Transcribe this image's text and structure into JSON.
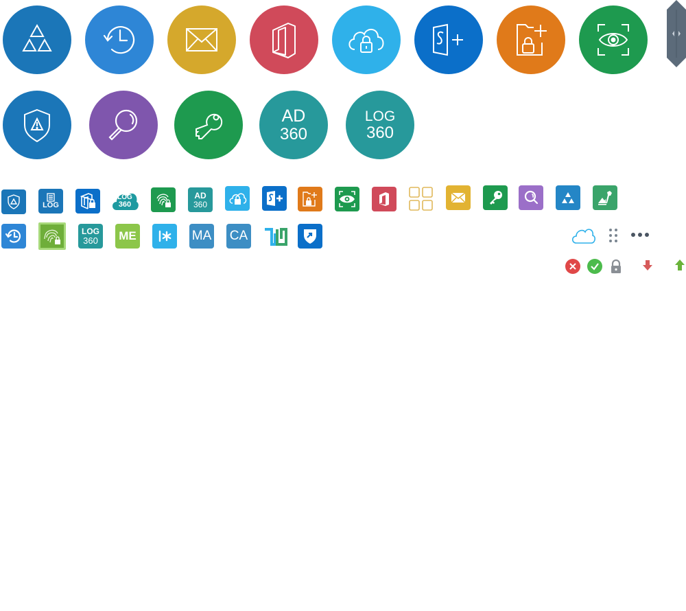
{
  "colors": {
    "blue_dark": "#1b76b8",
    "blue_mid": "#2e86d6",
    "mustard": "#d5a82c",
    "crimson": "#d04a5a",
    "sky": "#2fb1ea",
    "blue_royal": "#0b6fc9",
    "orange": "#e07a1a",
    "green": "#1e9a4f",
    "purple": "#7f56ad",
    "teal": "#27999b",
    "yellow_mail": "#e2b332",
    "lime": "#8cc64a",
    "green_pattern": "#6fae3a",
    "slider_gray": "#5c6b7a"
  },
  "circles_row1": [
    {
      "name": "triangles-icon"
    },
    {
      "name": "history-clock-icon"
    },
    {
      "name": "envelope-icon"
    },
    {
      "name": "office-door-icon"
    },
    {
      "name": "cloud-lock-icon"
    },
    {
      "name": "sharepoint-plus-icon"
    },
    {
      "name": "folder-lock-plus-icon"
    },
    {
      "name": "eye-scan-icon"
    }
  ],
  "circles_row2": {
    "ad360": {
      "line1": "AD",
      "line2": "360"
    },
    "log360": {
      "line1": "LOG",
      "line2": "360"
    }
  },
  "small_row1": {
    "log_doc": {
      "text": "LOG"
    },
    "log360_cloud": {
      "line1": "LOG",
      "line2": "360"
    },
    "ad360": {
      "line1": "AD",
      "line2": "360"
    }
  },
  "small_row2": {
    "log360": {
      "line1": "LOG",
      "line2": "360"
    },
    "me": {
      "text": "ME"
    },
    "ma": {
      "text": "MA"
    },
    "ca": {
      "text": "CA"
    }
  }
}
